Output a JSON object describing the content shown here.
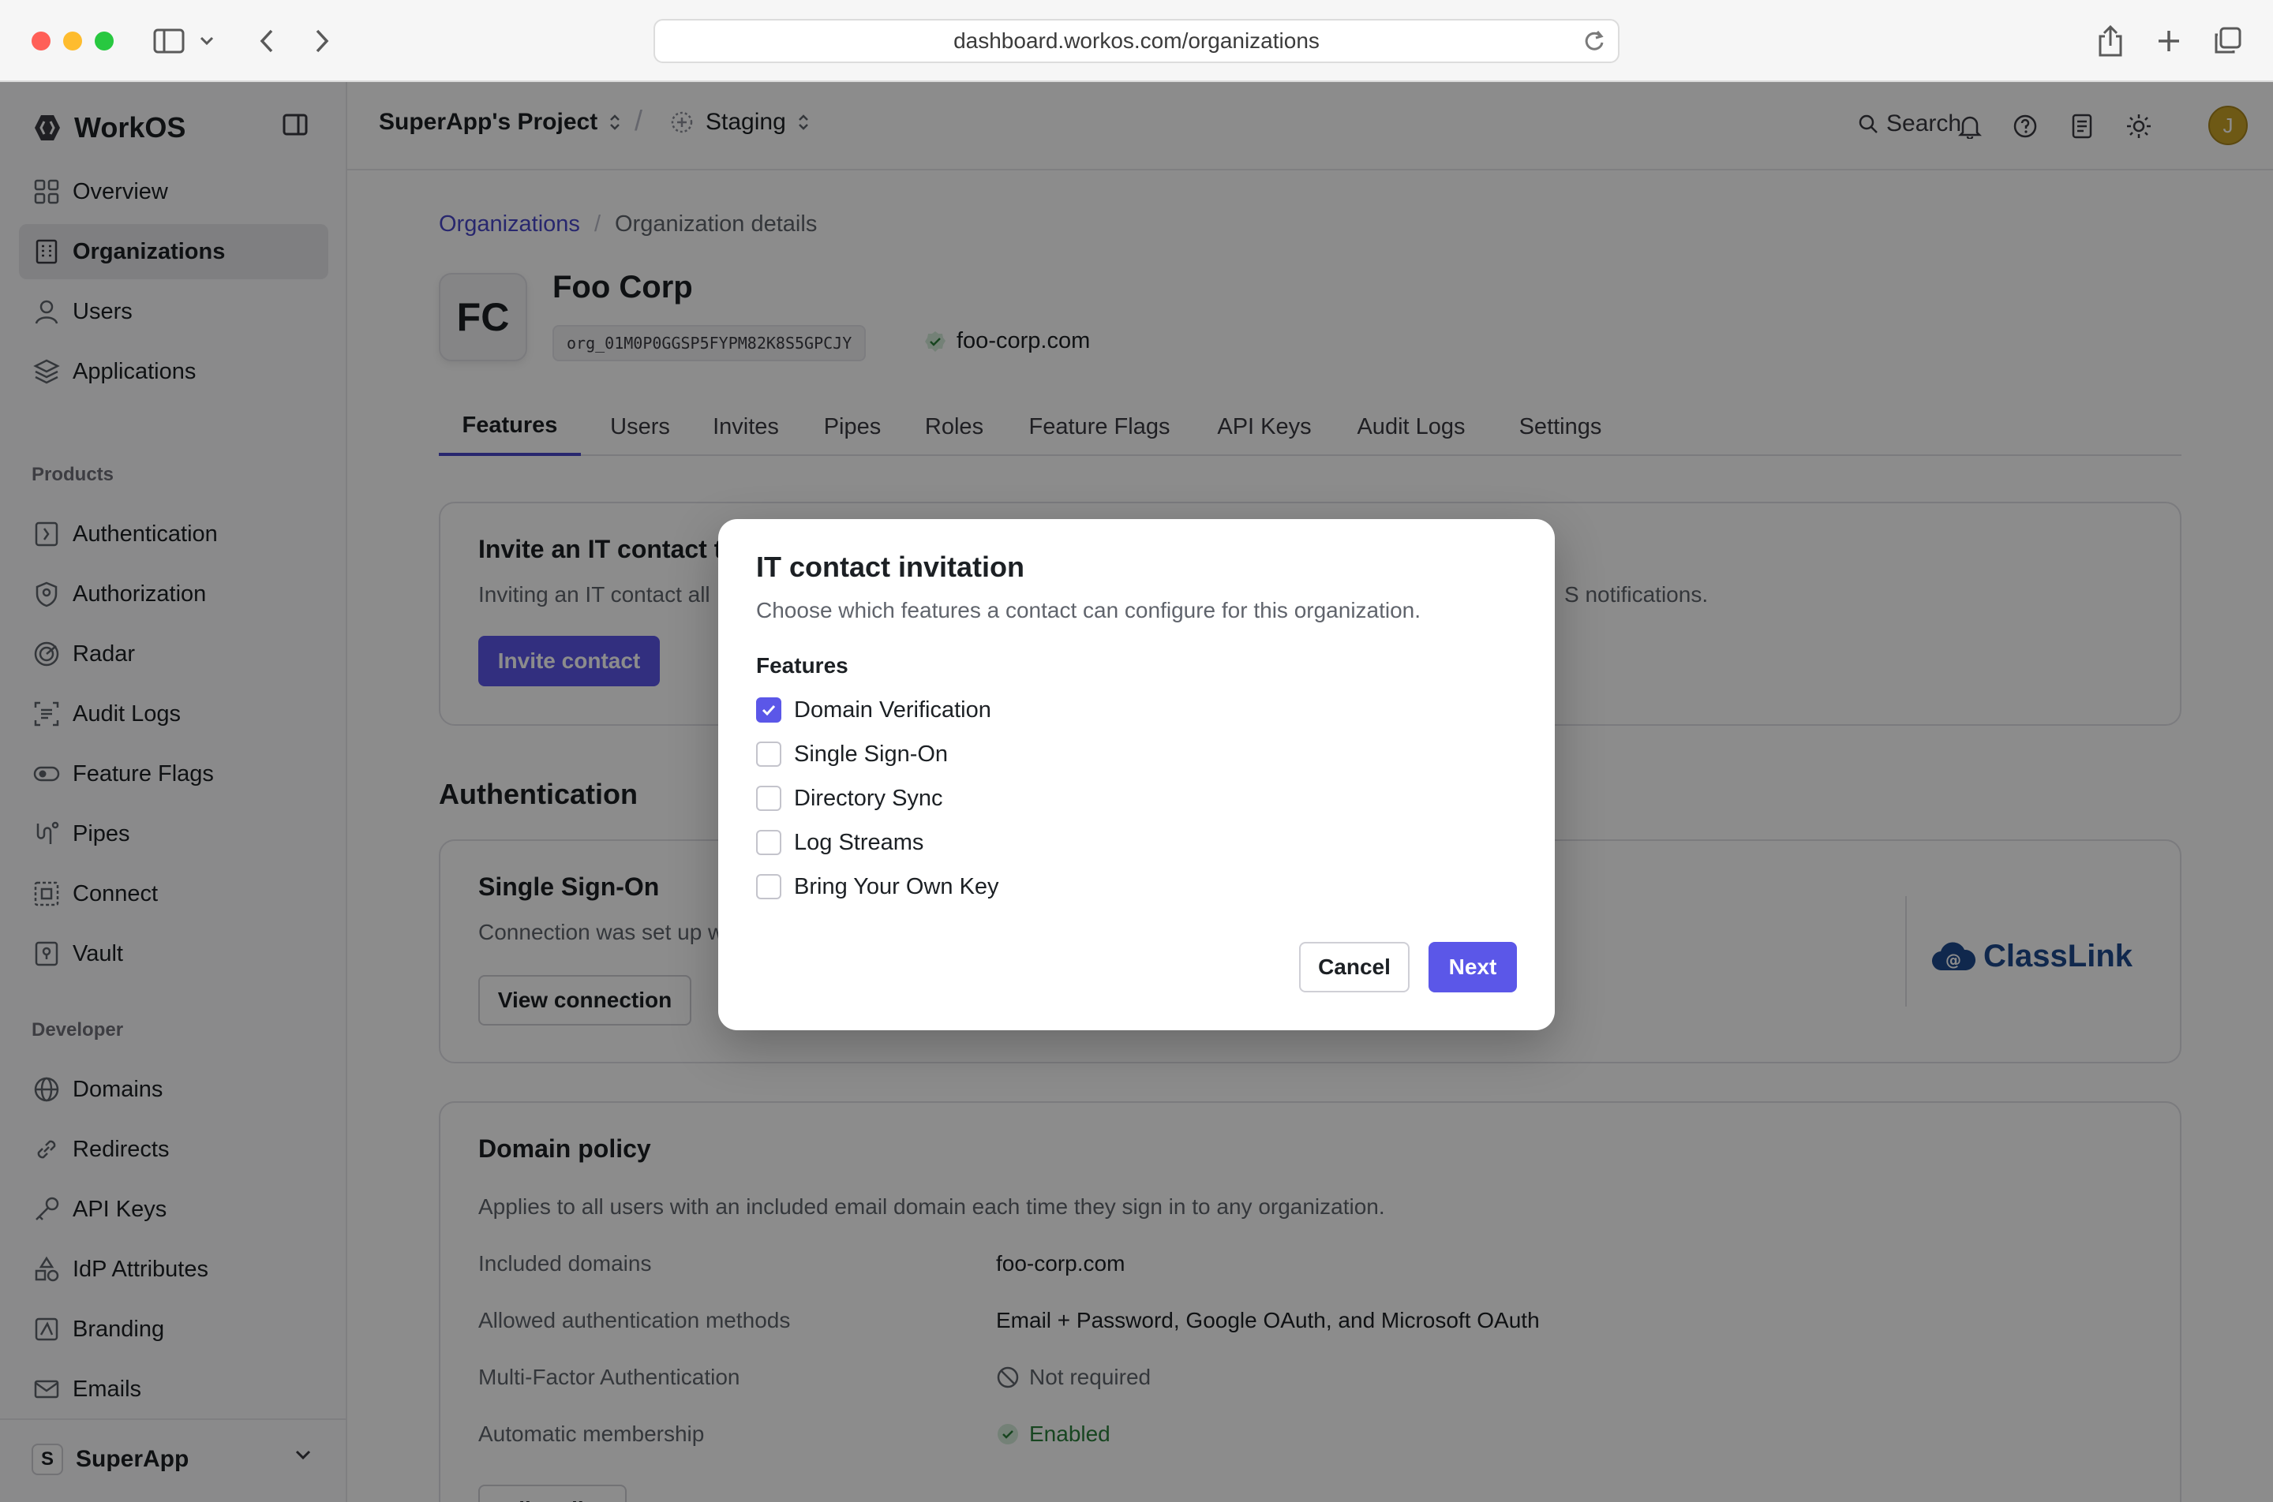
{
  "browser": {
    "url": "dashboard.workos.com/organizations"
  },
  "sidebar": {
    "brand": "WorkOS",
    "main_items": [
      {
        "label": "Overview",
        "icon": "grid-icon"
      },
      {
        "label": "Organizations",
        "icon": "building-icon",
        "active": true
      },
      {
        "label": "Users",
        "icon": "user-icon"
      },
      {
        "label": "Applications",
        "icon": "layers-icon"
      }
    ],
    "products_label": "Products",
    "product_items": [
      {
        "label": "Authentication",
        "icon": "auth-icon"
      },
      {
        "label": "Authorization",
        "icon": "shield-icon"
      },
      {
        "label": "Radar",
        "icon": "radar-icon"
      },
      {
        "label": "Audit Logs",
        "icon": "audit-icon"
      },
      {
        "label": "Feature Flags",
        "icon": "toggle-icon"
      },
      {
        "label": "Pipes",
        "icon": "pipes-icon"
      },
      {
        "label": "Connect",
        "icon": "connect-icon"
      },
      {
        "label": "Vault",
        "icon": "vault-icon"
      }
    ],
    "developer_label": "Developer",
    "developer_items": [
      {
        "label": "Domains",
        "icon": "globe-icon"
      },
      {
        "label": "Redirects",
        "icon": "link-icon"
      },
      {
        "label": "API Keys",
        "icon": "key-icon"
      },
      {
        "label": "IdP Attributes",
        "icon": "shapes-icon"
      },
      {
        "label": "Branding",
        "icon": "branding-icon"
      },
      {
        "label": "Emails",
        "icon": "mail-icon"
      }
    ],
    "workspace": {
      "badge": "S",
      "name": "SuperApp"
    }
  },
  "topbar": {
    "project": "SuperApp's Project",
    "environment": "Staging",
    "search": "Search",
    "avatar_initial": "J"
  },
  "page": {
    "breadcrumb_root": "Organizations",
    "breadcrumb_sep": "/",
    "breadcrumb_current": "Organization details",
    "org_initials": "FC",
    "org_name": "Foo Corp",
    "org_id": "org_01M0P0GGSP5FYPM82K8S5GPCJY",
    "org_domain": "foo-corp.com",
    "tabs": [
      "Features",
      "Users",
      "Invites",
      "Pipes",
      "Roles",
      "Feature Flags",
      "API Keys",
      "Audit Logs",
      "Settings"
    ],
    "active_tab": "Features"
  },
  "invite_card": {
    "title": "Invite an IT contact t",
    "text_left": "Inviting an IT contact all",
    "text_right": "S notifications.",
    "button": "Invite contact"
  },
  "auth_section": {
    "title": "Authentication",
    "sso_title": "Single Sign-On",
    "sso_text": "Connection was set up w",
    "sso_button": "View connection",
    "provider": "ClassLink"
  },
  "domain_policy": {
    "title": "Domain policy",
    "description": "Applies to all users with an included email domain each time they sign in to any organization.",
    "rows": [
      {
        "label": "Included domains",
        "value": "foo-corp.com"
      },
      {
        "label": "Allowed authentication methods",
        "value": "Email + Password, Google OAuth, and Microsoft OAuth"
      },
      {
        "label": "Multi-Factor Authentication",
        "value": "Not required"
      },
      {
        "label": "Automatic membership",
        "value": "Enabled"
      }
    ],
    "button": "Edit policy"
  },
  "modal": {
    "title": "IT contact invitation",
    "description": "Choose which features a contact can configure for this organization.",
    "features_label": "Features",
    "options": [
      {
        "label": "Domain Verification",
        "checked": true
      },
      {
        "label": "Single Sign-On",
        "checked": false
      },
      {
        "label": "Directory Sync",
        "checked": false
      },
      {
        "label": "Log Streams",
        "checked": false
      },
      {
        "label": "Bring Your Own Key",
        "checked": false
      }
    ],
    "cancel": "Cancel",
    "next": "Next"
  },
  "colors": {
    "accent": "#5b57e8",
    "link": "#4a47c9",
    "success": "#2a7e3b",
    "classlink": "#1e4a8c"
  }
}
